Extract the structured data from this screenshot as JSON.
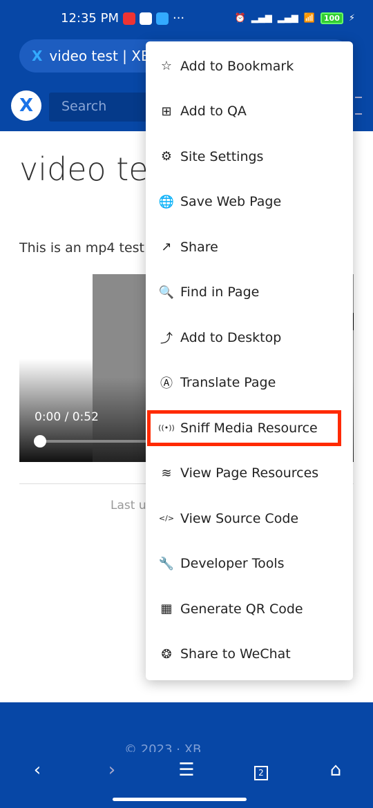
{
  "status": {
    "time": "12:35 PM",
    "battery": "100"
  },
  "browser": {
    "tab_title": "video test | XBrowser",
    "search_placeholder": "Search",
    "logo": "X"
  },
  "page": {
    "title": "video test",
    "description": "This is an mp4 test",
    "video_time": "0:00 / 0:52",
    "video_progress": 0,
    "last_updated": "Last u",
    "footer": "© 2023 · XB"
  },
  "menu": {
    "highlighted": "Sniff Media Resource",
    "highlight_color": "#ff2a00",
    "items": [
      {
        "label": "Add to Bookmark",
        "icon": "star-plus-icon",
        "glyph": "☆"
      },
      {
        "label": "Add to QA",
        "icon": "plus-square-icon",
        "glyph": "⊞"
      },
      {
        "label": "Site Settings",
        "icon": "gear-icon",
        "glyph": "⚙"
      },
      {
        "label": "Save Web Page",
        "icon": "globe-save-icon",
        "glyph": "🌐"
      },
      {
        "label": "Share",
        "icon": "share-icon",
        "glyph": "↗"
      },
      {
        "label": "Find in Page",
        "icon": "find-icon",
        "glyph": "🔍"
      },
      {
        "label": "Add to Desktop",
        "icon": "add-desktop-icon",
        "glyph": "⤴"
      },
      {
        "label": "Translate Page",
        "icon": "translate-icon",
        "glyph": "Ⓐ"
      },
      {
        "label": "Sniff Media Resource",
        "icon": "sniff-icon",
        "glyph": "((•))"
      },
      {
        "label": "View Page Resources",
        "icon": "layers-icon",
        "glyph": "≋"
      },
      {
        "label": "View Source Code",
        "icon": "code-icon",
        "glyph": "</>"
      },
      {
        "label": "Developer Tools",
        "icon": "wrench-icon",
        "glyph": "🔧"
      },
      {
        "label": "Generate QR Code",
        "icon": "qr-code-icon",
        "glyph": "▦"
      },
      {
        "label": "Share to WeChat",
        "icon": "aperture-icon",
        "glyph": "❂"
      }
    ]
  },
  "bottom_nav": {
    "tab_count": "2",
    "back": "‹",
    "forward": "›",
    "menu": "☰",
    "home": "⌂"
  },
  "colors": {
    "brand": "#0747a6"
  }
}
